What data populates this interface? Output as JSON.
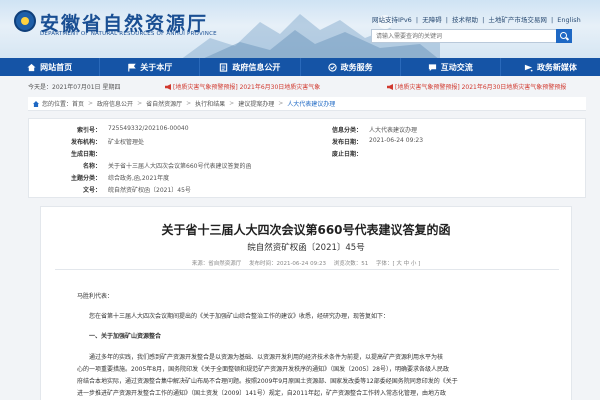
{
  "header": {
    "title": "安徽省自然资源厅",
    "subtitle": "DEPARTMENT OF NATURAL RESOURCES OF ANHUI PROVINCE",
    "top_links": [
      "网站支持IPv6",
      "|",
      "无障碍",
      "|",
      "技术帮助",
      "|",
      "土地矿产市场交易网",
      "|",
      "English"
    ],
    "search_placeholder": "请输入需要查询的关键词"
  },
  "nav": {
    "items": [
      {
        "label": "网站首页",
        "icon": "home-icon"
      },
      {
        "label": "关于本厅",
        "icon": "flag-icon"
      },
      {
        "label": "政府信息公开",
        "icon": "document-icon"
      },
      {
        "label": "政务服务",
        "icon": "service-icon"
      },
      {
        "label": "互动交流",
        "icon": "chat-icon"
      },
      {
        "label": "政务新媒体",
        "icon": "media-icon"
      }
    ]
  },
  "datebar": {
    "date": "今天是：2021年07月01日 星期四",
    "notice1": "[地质灾害气象预警预报] 2021年6月30日地质灾害气象",
    "notice2": "[地质灾害气象预警预报] 2021年6月30日地质灾害气象预警预报"
  },
  "breadcrumb": [
    "您的位置：首页",
    "政府信息公开",
    "省自然资源厅",
    "执行和结果",
    "建议提案办理",
    "人大代表建议办理"
  ],
  "meta": {
    "index_label": "索引号：",
    "index_value": "725549332/202106-00040",
    "category_label": "信息分类：",
    "category_value": "人大代表建议办理",
    "publisher_label": "发布机构：",
    "publisher_value": "矿业权管理处",
    "pubdate_label": "发布日期：",
    "pubdate_value": "2021-06-24 09:23",
    "date_label": "生成日期：",
    "date_value": "",
    "expire_label": "废止日期：",
    "expire_value": "",
    "name_label": "名称：",
    "name_value": "关于省十三届人大四次会议第660号代表建议答复的函",
    "topic_label": "主题分类：",
    "topic_value": "综合政务,函,2021年度",
    "docno_label": "文号：",
    "docno_value": "皖自然资矿权函〔2021〕45号"
  },
  "article": {
    "title": "关于省十三届人大四次会议第660号代表建议答复的函",
    "docno": "皖自然资矿权函〔2021〕45号",
    "info": [
      "来源：省自然资源厅",
      "发布时间：2021-06-24 09:23",
      "浏览次数：51",
      "字体：[ 大 中 小 ]"
    ],
    "greeting": "马胜利代表：",
    "intro": "您在省第十三届人大四次会议期间提出的《关于加强矿山综合整治工作的建议》收悉，经研究办理，现答复如下：",
    "section1": "一、关于加强矿山资源整合",
    "body": [
      "通过多年的实践，我们感到矿产资源开发整合是以资源为基础、以资源开发利用的经济技术条件为前提，以提高矿产资源利用水平为核",
      "心的一项重要措施。2005年8月，国务院印发《关于全面整顿和规范矿产资源开发秩序的通知》（国发〔2005〕28号），明确要求各级人民政",
      "府结合本地实际，通过资源整合集中解决矿山布局不合理问题。按照2009年9月原国土资源部、国家发改委等12部委经国务院同意印发的《关于",
      "进一步推进矿产资源开发整合工作的通知》（国土资发〔2009〕141号）规定，自2011年起，矿产资源整合工作转入常态化管理，由地方政"
    ]
  }
}
